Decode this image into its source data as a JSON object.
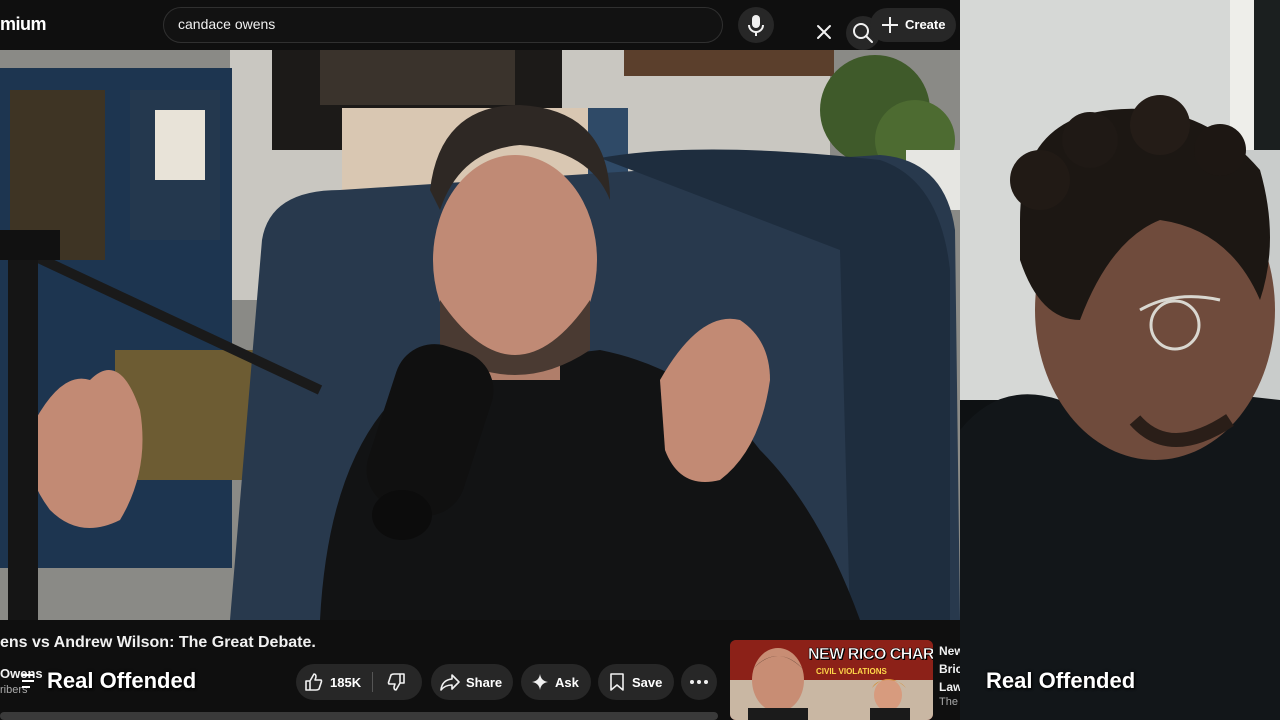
{
  "brand": {
    "logo_text": "mium"
  },
  "search": {
    "value": "candace owens",
    "placeholder": "Search"
  },
  "header": {
    "create_label": "Create"
  },
  "video": {
    "title": "ens vs Andrew Wilson: The Great Debate.",
    "channel_name": "Owens",
    "subscribers": "ribers",
    "like_count": "185K",
    "share_label": "Share",
    "ask_label": "Ask",
    "save_label": "Save"
  },
  "recommended": {
    "thumb_headline": "NEW RICO CHARGES!",
    "thumb_sub": "CIVIL VIOLATIONS",
    "title": "New\nBric\nLaw",
    "channel": "The"
  },
  "overlay": {
    "left_label": "Real Offended",
    "right_label": "Real Offended"
  },
  "colors": {
    "bg": "#0f0f0f",
    "pill": "#272727",
    "text": "#f1f1f1",
    "muted": "#aaaaaa"
  }
}
